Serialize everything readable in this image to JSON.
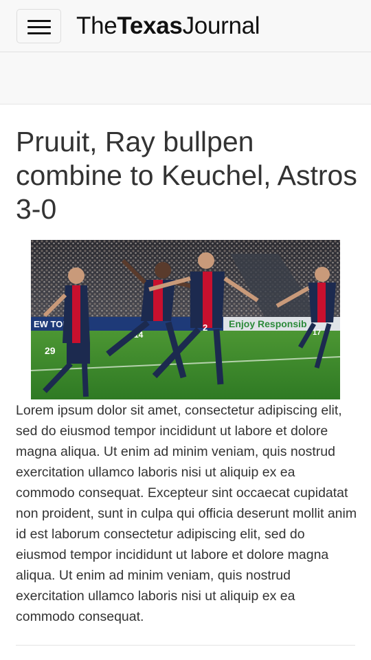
{
  "navbar": {
    "menu_icon": "hamburger-menu-icon",
    "brand_prefix": "The",
    "brand_bold": "Texas",
    "brand_suffix": "Journal"
  },
  "article": {
    "headline": "Pruuit, Ray bullpen combine to Keuchel, Astros 3-0",
    "image_alt": "Soccer players in dark blue and red jerseys celebrating on the pitch in front of a crowd",
    "body": "Lorem ipsum dolor sit amet, consectetur adipiscing elit, sed do eiusmod tempor incididunt ut labore et dolore magna aliqua. Ut enim ad minim veniam, quis nostrud exercitation ullamco laboris nisi ut aliquip ex ea commodo consequat. Excepteur sint occaecat cupidatat non proident, sunt in culpa qui officia deserunt mollit anim id est laborum consectetur adipiscing elit, sed do eiusmod tempor incididunt ut labore et dolore magna aliqua. Ut enim ad minim veniam, quis nostrud exercitation ullamco laboris nisi ut aliquip ex ea commodo consequat."
  },
  "photo_details": {
    "banner_left": "EW TOUR",
    "banner_right": "Enjoy Responsib",
    "jersey_numbers": [
      "29",
      "14",
      "2",
      "17"
    ]
  },
  "colors": {
    "navbar_bg": "#f8f8f8",
    "text": "#333333",
    "jersey_navy": "#1c2a4f",
    "jersey_red": "#c8102e",
    "pitch": "#3f8a2c"
  }
}
